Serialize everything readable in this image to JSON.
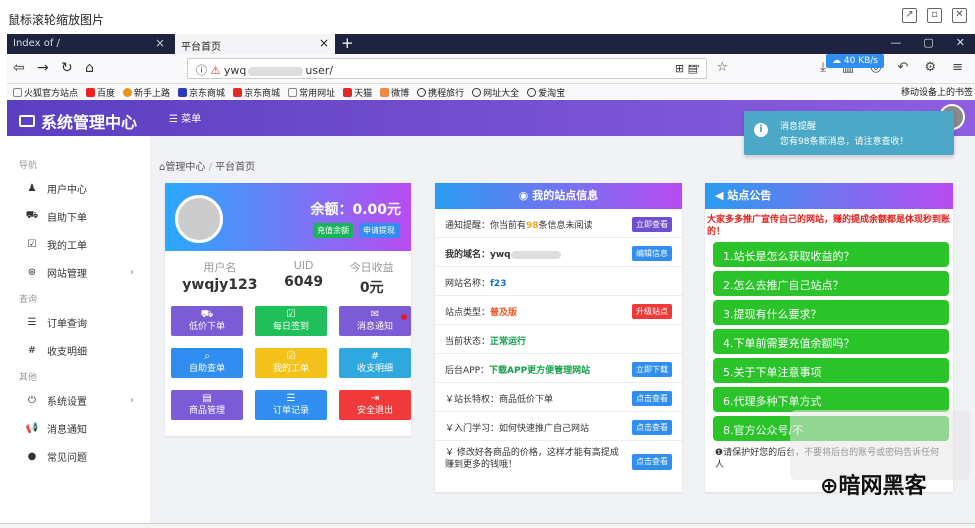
{
  "viewer": {
    "title": "鼠标滚轮缩放图片"
  },
  "browser": {
    "tab1": "Index of /",
    "tab2": "平台首页",
    "url_prefix": "ywq",
    "url_suffix": "user/",
    "speed": "40 KB/s",
    "bookmarks": [
      "火狐官方站点",
      "百度",
      "新手上路",
      "京东商城",
      "京东商城",
      "常用网址",
      "天猫",
      "微博",
      "携程旅行",
      "网址大全",
      "爱淘宝"
    ],
    "mobile_bm": "移动设备上的书签"
  },
  "app": {
    "brand": "系统管理中心",
    "menu": "菜单",
    "user": "ywqjy123",
    "toast_title": "消息提醒",
    "toast_body": "您有98条新消息，请注意查收！"
  },
  "sidebar": {
    "sections": [
      "导航",
      "查询",
      "其他"
    ],
    "nav": [
      "用户中心",
      "自助下单",
      "我的工单",
      "网站管理"
    ],
    "query": [
      "订单查询",
      "收支明细"
    ],
    "other": [
      "系统设置",
      "消息通知",
      "常见问题"
    ]
  },
  "breadcrumb": {
    "home": "管理中心",
    "sep": "/",
    "current": "平台首页"
  },
  "user_card": {
    "balance": "余额：0.00元",
    "btn_recharge": "充值余额",
    "btn_withdraw": "申请提现",
    "labels": [
      "用户名",
      "UID",
      "今日收益"
    ],
    "values": [
      "ywqjy123",
      "6049",
      "0元"
    ],
    "grid": [
      "低价下单",
      "每日签到",
      "消息通知",
      "自助查单",
      "我的工单",
      "收支明细",
      "商品管理",
      "订单记录",
      "安全退出"
    ]
  },
  "site_info": {
    "title": "我的站点信息",
    "rows": [
      {
        "pre": "通知提醒：你当前有",
        "hl": "98",
        "post": "条信息未阅读",
        "btn": "立即查看"
      },
      {
        "pre": "我的域名：ywq",
        "hl": "",
        "post": "",
        "btn": "编辑信息"
      },
      {
        "pre": "网站名称：",
        "hl": "f23",
        "post": "",
        "btn": ""
      },
      {
        "pre": "站点类型：",
        "hl": "普及版",
        "post": "",
        "btn": "升级站点"
      },
      {
        "pre": "当前状态：",
        "hl": "正常运行",
        "post": "",
        "btn": ""
      },
      {
        "pre": "后台APP：",
        "hl": "下载APP更方便管理网站",
        "post": "",
        "btn": "立即下载"
      },
      {
        "pre": "￥站长特权：商品低价下单",
        "hl": "",
        "post": "",
        "btn": "点击查看"
      },
      {
        "pre": "￥入门学习：如何快速推广自己网站",
        "hl": "",
        "post": "",
        "btn": "点击查看"
      },
      {
        "pre": "￥ 修改好各商品的价格，这样才能有高提成赚到更多的钱哦！",
        "hl": "",
        "post": "",
        "btn": "点击查看"
      }
    ]
  },
  "notice": {
    "title": "站点公告",
    "top": "大家多多推广宣传自己的网站，赚的提成余额都是体现秒到账的！",
    "items": [
      "1.站长是怎么获取收益的？",
      "2.怎么去推广自己站点？",
      "3.提现有什么要求？",
      "4.下单前需要充值余额吗？",
      "5.关于下单注意事项",
      "6.代理多种下单方式",
      "8.官方公众号/不"
    ],
    "foot": "请保护好您的后台，不要将后台的账号或密码告诉任何人"
  },
  "watermark": "暗网黑客"
}
